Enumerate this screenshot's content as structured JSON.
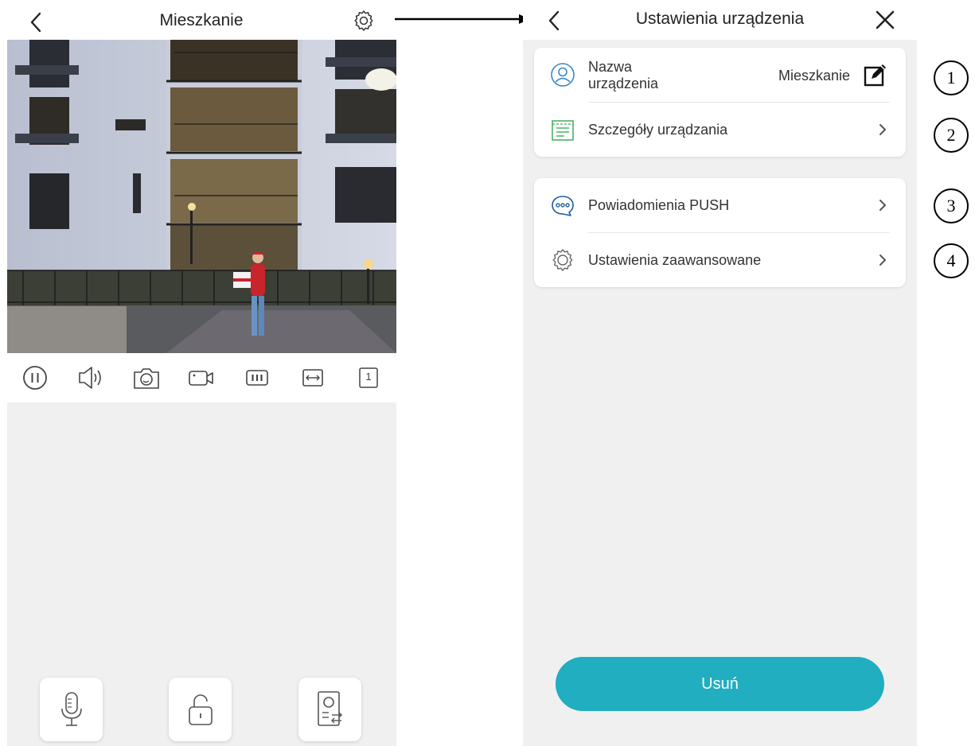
{
  "left_screen": {
    "title": "Mieszkanie",
    "controls": [
      "pause-icon",
      "speaker-icon",
      "camera-icon",
      "video-record-icon",
      "stream-quality-icon",
      "fit-screen-icon",
      "channel-one-icon"
    ],
    "channel_number": "1",
    "bottom_buttons": [
      "microphone-icon",
      "unlock-icon",
      "switch-panel-icon"
    ]
  },
  "right_screen": {
    "title": "Ustawienia urządzenia",
    "device_name_label": "Nazwa urządzenia",
    "device_name_value": "Mieszkanie",
    "details_label": "Szczegóły urządzania",
    "push_label": "Powiadomienia PUSH",
    "advanced_label": "Ustawienia zaawansowane",
    "delete_label": "Usuń"
  },
  "callouts": [
    "1",
    "2",
    "3",
    "4"
  ],
  "colors": {
    "accent": "#20aec0",
    "background_gray": "#f0f0f0",
    "icon_blue": "#3a88c8",
    "icon_green": "#3fae5a"
  }
}
